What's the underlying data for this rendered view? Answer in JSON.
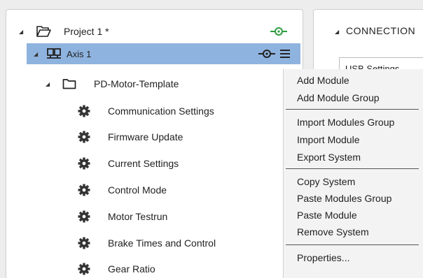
{
  "tree": {
    "project": {
      "label": "Project 1 *"
    },
    "axis": {
      "label": "Axis 1"
    },
    "template": {
      "label": "PD-Motor-Template"
    },
    "modules": [
      {
        "label": "Communication Settings"
      },
      {
        "label": "Firmware Update"
      },
      {
        "label": "Current Settings"
      },
      {
        "label": "Control Mode"
      },
      {
        "label": "Motor Testrun"
      },
      {
        "label": "Brake Times and Control"
      },
      {
        "label": "Gear Ratio"
      }
    ],
    "connected_color": "#2e9e3e"
  },
  "right_panel": {
    "title": "CONNECTION",
    "tab_label": "USB Settings"
  },
  "context_menu": {
    "items": [
      {
        "label": "Add Module"
      },
      {
        "label": "Add Module Group"
      },
      {
        "label": "Import Modules Group"
      },
      {
        "label": "Import Module"
      },
      {
        "label": "Export System"
      },
      {
        "label": "Copy System"
      },
      {
        "label": "Paste Modules Group"
      },
      {
        "label": "Paste Module"
      },
      {
        "label": "Remove System"
      },
      {
        "label": "Properties..."
      }
    ]
  },
  "colors": {
    "selection": "#8fb3df",
    "connected": "#2e9e3e"
  }
}
